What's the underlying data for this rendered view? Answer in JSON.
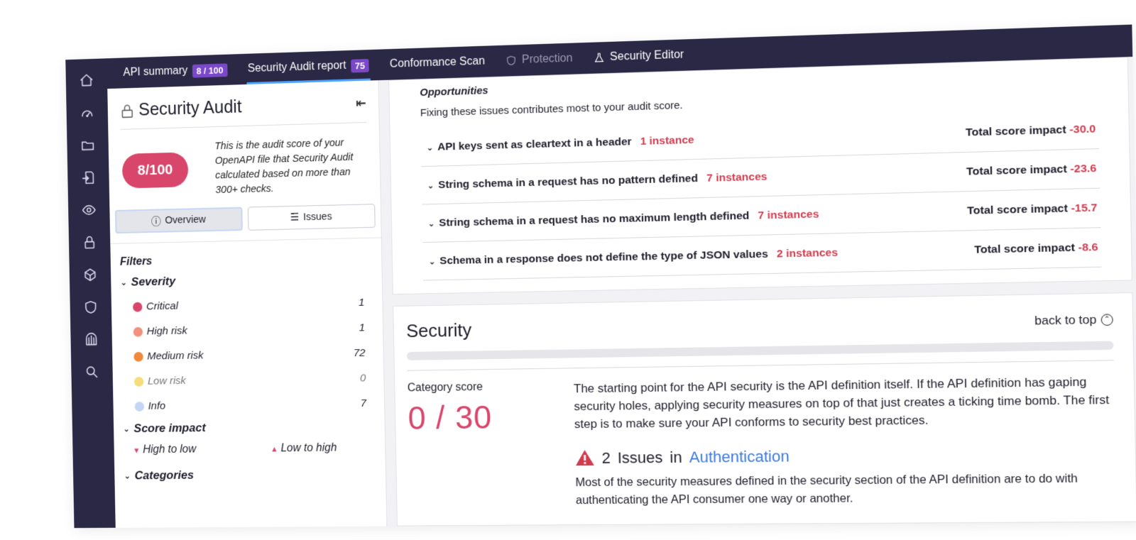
{
  "colors": {
    "accent": "#d8466b",
    "rail": "#2b2845",
    "tab_badge": "#7a48c9",
    "link": "#3d7ae0",
    "active_tab_underline": "#4aa3ff"
  },
  "rail": {
    "icons": [
      "home-icon",
      "dashboard-icon",
      "folder-icon",
      "import-icon",
      "eye-icon",
      "lock-icon",
      "cube-icon",
      "shield-icon",
      "firewall-icon",
      "search-icon"
    ]
  },
  "tabs": {
    "api_summary": {
      "label": "API summary",
      "badge": "8 / 100"
    },
    "audit_report": {
      "label": "Security Audit report",
      "badge": "75"
    },
    "conformance": {
      "label": "Conformance Scan"
    },
    "protection": {
      "label": "Protection"
    },
    "editor": {
      "label": "Security Editor"
    }
  },
  "panel": {
    "title": "Security Audit",
    "score": "8/100",
    "score_description": "This is the audit score of your OpenAPI file that Security Audit calculated based on more than 300+ checks.",
    "overview_label": "Overview",
    "issues_label": "Issues",
    "filters_title": "Filters",
    "severity_title": "Severity",
    "severity": [
      {
        "label": "Critical",
        "count": "1",
        "color": "#d8466b"
      },
      {
        "label": "High risk",
        "count": "1",
        "color": "#f1917e"
      },
      {
        "label": "Medium risk",
        "count": "72",
        "color": "#ef8a3c"
      },
      {
        "label": "Low risk",
        "count": "0",
        "color": "#f4dd7a"
      },
      {
        "label": "Info",
        "count": "7",
        "color": "#c4d6f5"
      }
    ],
    "score_impact_title": "Score impact",
    "sort_high_low": "High to low",
    "sort_low_high": "Low to high",
    "categories_title": "Categories"
  },
  "opportunities": {
    "title": "Opportunities",
    "subtitle": "Fixing these issues contributes most to your audit score.",
    "impact_label": "Total score impact",
    "items": [
      {
        "title": "API keys sent as cleartext in a header",
        "instances": "1 instance",
        "impact": "-30.0"
      },
      {
        "title": "String schema in a request has no pattern defined",
        "instances": "7 instances",
        "impact": "-23.6"
      },
      {
        "title": "String schema in a request has no maximum length defined",
        "instances": "7 instances",
        "impact": "-15.7"
      },
      {
        "title": "Schema in a response does not define the type of JSON values",
        "instances": "2 instances",
        "impact": "-8.6"
      }
    ]
  },
  "security": {
    "title": "Security",
    "back_to_top": "back to top",
    "progress": 0,
    "category_label": "Category score",
    "category_score": "0 / 30",
    "description": "The starting point for the API security is the API definition itself. If the API definition has gaping security holes, applying security measures on top of that just creates a ticking time bomb. The first step is to make sure your API conforms to security best practices.",
    "issues_count": "2",
    "issues_word": "Issues",
    "issues_in": "in",
    "issues_category": "Authentication",
    "issues_description": "Most of the security measures defined in the security section of the API definition are to do with authenticating the API consumer one way or another."
  }
}
